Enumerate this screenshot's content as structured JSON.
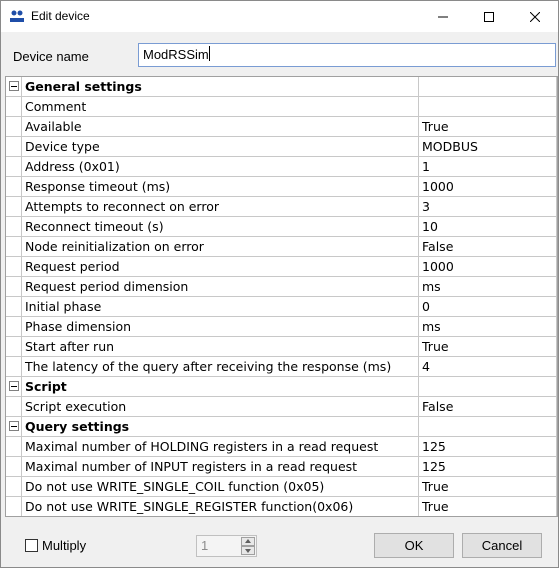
{
  "window": {
    "title": "Edit device"
  },
  "device_name": {
    "label": "Device name",
    "value": "ModRSSim"
  },
  "sections": [
    {
      "title": "General settings",
      "rows": [
        {
          "name": "Comment",
          "value": ""
        },
        {
          "name": "Available",
          "value": "True"
        },
        {
          "name": "Device type",
          "value": "MODBUS"
        },
        {
          "name": "Address    (0x01)",
          "value": "1"
        },
        {
          "name": "Response timeout (ms)",
          "value": "1000"
        },
        {
          "name": "Attempts to reconnect on error",
          "value": "3"
        },
        {
          "name": "Reconnect timeout (s)",
          "value": "10"
        },
        {
          "name": "Node reinitialization on error",
          "value": "False"
        },
        {
          "name": "Request period",
          "value": "1000"
        },
        {
          "name": "Request period dimension",
          "value": "ms"
        },
        {
          "name": "Initial phase",
          "value": "0"
        },
        {
          "name": "Phase dimension",
          "value": "ms"
        },
        {
          "name": "Start after run",
          "value": "True"
        },
        {
          "name": "The latency of the query after receiving the response (ms)",
          "value": "4"
        }
      ]
    },
    {
      "title": "Script",
      "rows": [
        {
          "name": "Script execution",
          "value": "False"
        }
      ]
    },
    {
      "title": "Query settings",
      "rows": [
        {
          "name": "Maximal number of HOLDING registers in a read request",
          "value": "125"
        },
        {
          "name": "Maximal number of INPUT registers in a read request",
          "value": "125"
        },
        {
          "name": "Do not use WRITE_SINGLE_COIL function (0x05)",
          "value": "True"
        },
        {
          "name": "Do not use WRITE_SINGLE_REGISTER function(0x06)",
          "value": "True"
        }
      ]
    }
  ],
  "footer": {
    "multiply_label": "Multiply",
    "multiply_checked": false,
    "spin_value": "1",
    "ok_label": "OK",
    "cancel_label": "Cancel"
  },
  "icons": {
    "app": "sopc-app-icon",
    "minimize": "minimize-icon",
    "maximize": "maximize-icon",
    "close": "close-icon",
    "expander": "collapse-minus-icon"
  }
}
